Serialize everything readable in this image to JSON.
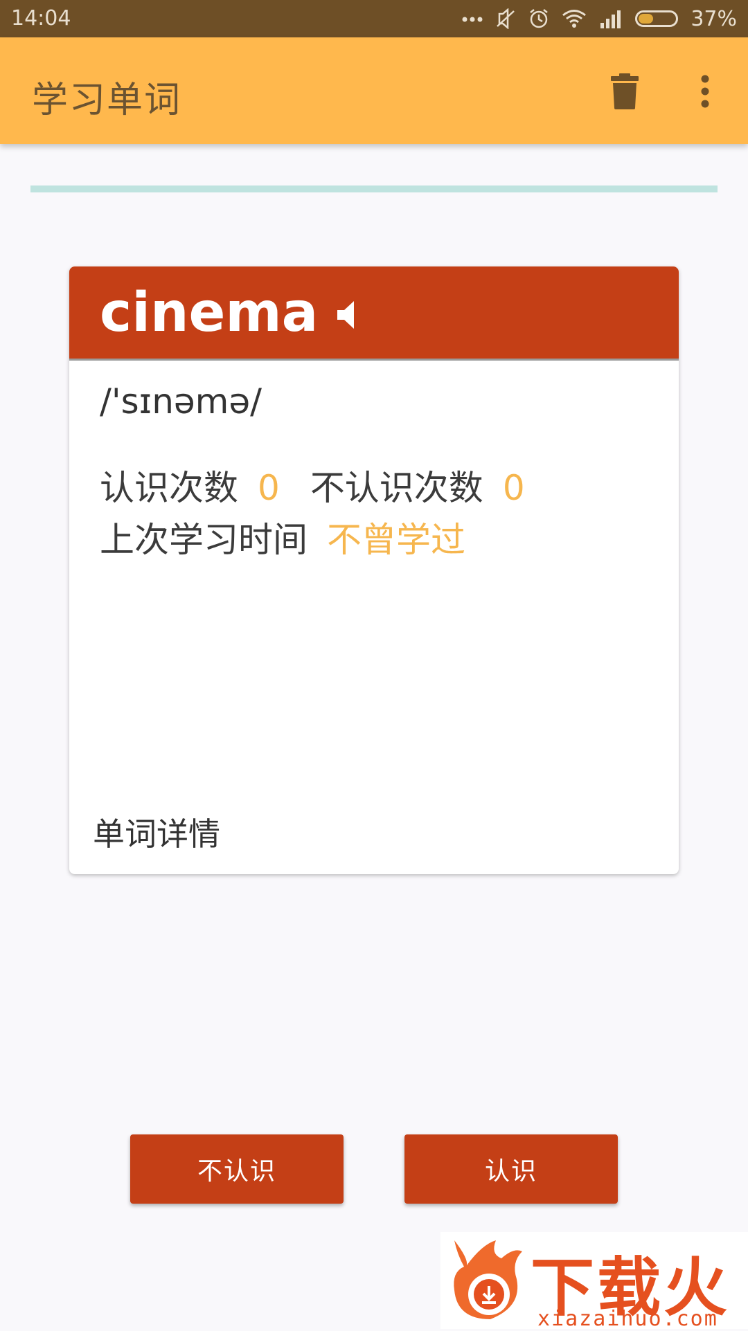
{
  "status_bar": {
    "time": "14:04",
    "battery": "37%",
    "battery_level": 0.37,
    "icons": [
      "more-dots-icon",
      "mute-icon",
      "alarm-icon",
      "wifi-icon",
      "signal-icon",
      "battery-icon"
    ]
  },
  "app_bar": {
    "title": "学习单词",
    "actions": [
      "trash-icon",
      "more-vert-icon"
    ]
  },
  "card": {
    "word": "cinema",
    "phonetic": "/'sɪnəmə/",
    "known_label": "认识次数",
    "known_count": "0",
    "unknown_label": "不认识次数",
    "unknown_count": "0",
    "last_study_label": "上次学习时间",
    "last_study_value": "不曾学过",
    "detail_link": "单词详情"
  },
  "buttons": {
    "unknown": "不认识",
    "known": "认识"
  },
  "watermark": {
    "text": "下载火",
    "domain": "xiazaihuo.com"
  },
  "colors": {
    "status_bar": "#6e4f26",
    "app_bar": "#ffb84d",
    "accent": "#c43f16",
    "highlight": "#f6b64e",
    "progress": "#bfe3df"
  }
}
